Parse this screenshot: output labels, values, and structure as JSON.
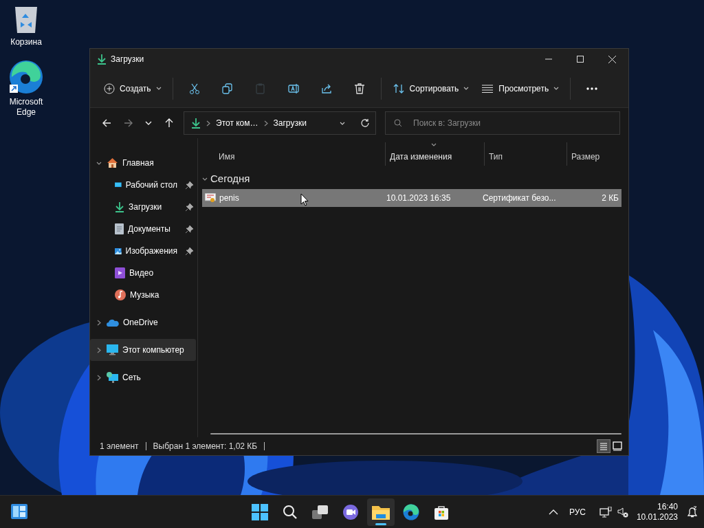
{
  "desktop_icons": [
    {
      "kind": "recycle",
      "label": "Корзина"
    },
    {
      "kind": "edge",
      "label": "Microsoft Edge"
    }
  ],
  "window": {
    "title": "Загрузки",
    "toolbar": [
      {
        "kind": "new",
        "label": "Создать",
        "disabled": false
      },
      {
        "kind": "cut",
        "disabled": false
      },
      {
        "kind": "copy",
        "disabled": false
      },
      {
        "kind": "paste",
        "disabled": true
      },
      {
        "kind": "rename",
        "disabled": false
      },
      {
        "kind": "share",
        "disabled": false
      },
      {
        "kind": "delete",
        "disabled": false
      },
      {
        "kind": "sort",
        "label": "Сортировать",
        "disabled": false
      },
      {
        "kind": "view",
        "label": "Просмотреть",
        "disabled": false
      },
      {
        "kind": "more",
        "disabled": false
      }
    ],
    "nav": [
      {
        "kind": "back",
        "disabled": false
      },
      {
        "kind": "forward",
        "disabled": true
      },
      {
        "kind": "recent",
        "disabled": false
      },
      {
        "kind": "up",
        "disabled": false
      }
    ],
    "address": {
      "segments": [
        "Этот ком…",
        "Загрузки"
      ]
    },
    "search": {
      "placeholder": "Поиск в: Загрузки"
    },
    "sidebar": {
      "items": [
        {
          "kind": "home",
          "label": "Главная",
          "expanded": true,
          "selected": false,
          "children": [
            {
              "kind": "desktop",
              "label": "Рабочий стол",
              "pinned": true,
              "selected": false
            },
            {
              "kind": "downloads",
              "label": "Загрузки",
              "pinned": true,
              "selected": false
            },
            {
              "kind": "documents",
              "label": "Документы",
              "pinned": true,
              "selected": false
            },
            {
              "kind": "pictures",
              "label": "Изображения",
              "pinned": true,
              "selected": false
            },
            {
              "kind": "video",
              "label": "Видео",
              "pinned": false,
              "selected": false
            },
            {
              "kind": "music",
              "label": "Музыка",
              "pinned": false,
              "selected": false
            }
          ]
        },
        {
          "kind": "onedrive",
          "label": "OneDrive",
          "expanded": false,
          "selected": false
        },
        {
          "kind": "pc",
          "label": "Этот компьютер",
          "expanded": false,
          "selected": true
        },
        {
          "kind": "network",
          "label": "Сеть",
          "expanded": false,
          "selected": false
        }
      ]
    },
    "table": {
      "columns": [
        {
          "label": "Имя",
          "sorted": false
        },
        {
          "label": "Дата изменения",
          "sorted": true
        },
        {
          "label": "Тип",
          "sorted": false
        },
        {
          "label": "Размер",
          "sorted": false
        }
      ],
      "groups": [
        {
          "label": "Сегодня",
          "expanded": true,
          "rows": [
            {
              "kind": "certificate",
              "name": "penis",
              "date": "10.01.2023 16:35",
              "type": "Сертификат безо...",
              "size": "2 КБ",
              "selected": true
            }
          ]
        }
      ]
    },
    "status_bar": {
      "count": "1 элемент",
      "selection": "Выбран 1 элемент: 1,02 КБ",
      "views": [
        {
          "kind": "details",
          "selected": true
        },
        {
          "kind": "tiles",
          "selected": false
        }
      ]
    }
  },
  "taskbar": {
    "apps": [
      {
        "kind": "start",
        "active": false
      },
      {
        "kind": "search",
        "active": false
      },
      {
        "kind": "taskview",
        "active": false
      },
      {
        "kind": "chat",
        "active": false
      },
      {
        "kind": "explorer",
        "active": true
      },
      {
        "kind": "edge",
        "active": false
      },
      {
        "kind": "store",
        "active": false
      }
    ],
    "language": "РУС",
    "time": "16:40",
    "date": "10.01.2023"
  }
}
